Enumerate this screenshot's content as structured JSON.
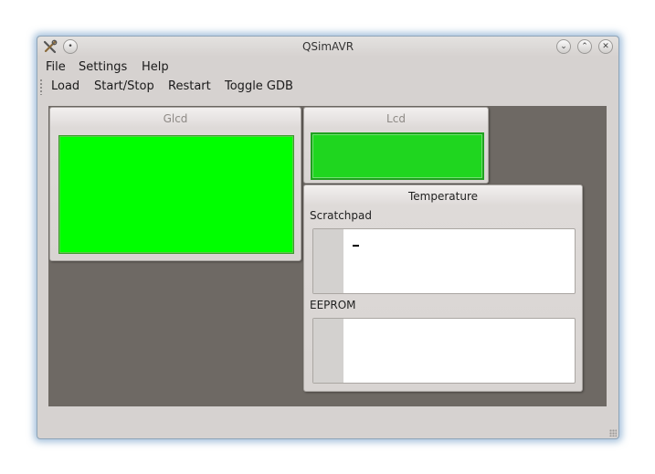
{
  "window": {
    "title": "QSimAVR"
  },
  "icons": {
    "app": "qsimavr-app-icon",
    "menu": "window-menu-icon",
    "minimize": "minimize-icon",
    "maximize": "maximize-icon",
    "close": "close-icon"
  },
  "menubar": {
    "items": [
      "File",
      "Settings",
      "Help"
    ]
  },
  "toolbar": {
    "items": [
      "Load",
      "Start/Stop",
      "Restart",
      "Toggle GDB"
    ]
  },
  "glcd": {
    "title": "Glcd",
    "screen_color": "#00ff00"
  },
  "lcd": {
    "title": "Lcd",
    "screen_color": "#1fd61f"
  },
  "temperature": {
    "title": "Temperature",
    "scratchpad_label": "Scratchpad",
    "scratchpad_value": "",
    "eeprom_label": "EEPROM",
    "eeprom_value": ""
  },
  "colors": {
    "mdi_background": "#6e6964",
    "window_glow": "#5a8cbe"
  }
}
